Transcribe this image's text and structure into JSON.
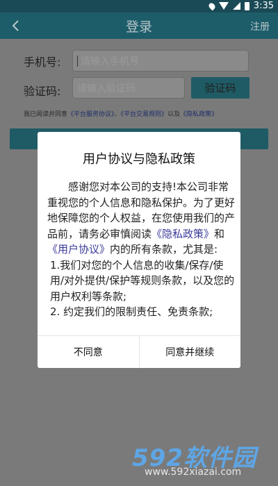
{
  "status_bar": {
    "time": "3:35",
    "icons": [
      "location-icon",
      "wifi-icon",
      "signal-icon",
      "battery-icon"
    ]
  },
  "header": {
    "title": "登录",
    "right_action": "注册",
    "back_icon": "chevron-left-icon"
  },
  "form": {
    "phone_label": "手机号:",
    "phone_placeholder": "请输入手机号",
    "code_label": "验证码:",
    "code_placeholder": "请输入验证码",
    "code_button": "验证码",
    "agreement_prefix": "我已阅读并同意",
    "agreement_link1": "《平台服务协议》",
    "agreement_sep": "、",
    "agreement_link2": "《平台交易规则》",
    "agreement_and": "以及",
    "agreement_link3": "《隐私政策》"
  },
  "dialog": {
    "title": "用户协议与隐私政策",
    "para1_a": "感谢您对本公司的支持!本公司非常重视您的个人信息和隐私保护。为了更好地保障您的个人权益，在您使用我们的产品前，请务必审慎阅读",
    "para1_link1": "《隐私政策》",
    "para1_and": "和",
    "para1_link2": "《用户协议》",
    "para1_b": "内的所有条款，尤其是:",
    "item1": "1.我们对您的个人信息的收集/保存/使用/对外提供/保护等规则条款，以及您的用户权利等条款;",
    "item2": "2. 约定我们的限制责任、免责条款;",
    "disagree": "不同意",
    "agree": "同意并继续"
  },
  "watermark": {
    "logo": "592软件园",
    "url": "www.592xiazai.com"
  },
  "colors": {
    "header": "#1d5d6a",
    "overlay": "#7a7a7a",
    "accent_button": "#1f5b65",
    "dialog": "#ffffff"
  }
}
